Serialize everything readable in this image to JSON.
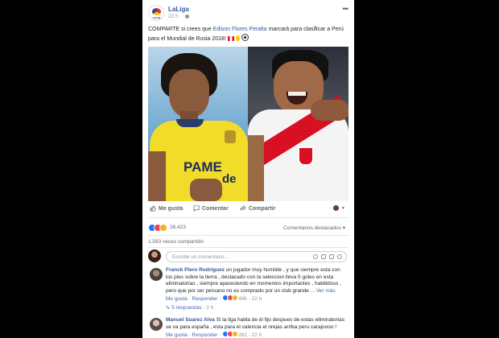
{
  "post": {
    "page_name": "LaLiga",
    "time": "22 h",
    "logo_text": "LaLiga",
    "text_before": "COMPARTE si crees que ",
    "text_link": "Edison Flores Peralta",
    "text_after": " marcará para clasificar a Perú para el Mundial de Rusia 2018! "
  },
  "photo": {
    "left_shirt_text": "PAME",
    "left_shirt_text2": "de"
  },
  "actions": {
    "like": "Me gusta",
    "comment": "Comentar",
    "share": "Compartir"
  },
  "reactions": {
    "count": "26.423",
    "sort_label": "Comentarios destacados",
    "shares": "1.593 veces compartido"
  },
  "composer": {
    "placeholder": "Escribe un comentario..."
  },
  "comments": [
    {
      "name": "Franck Piero Rodriguez",
      "body": " un jugador muy humilde , y que siempre esta con los pies sobre la tierra , destacado con la seleccion lleva 5 goles en esta eliminatorias , siempre apareciendo en momentos importantes , habilidoso , pero que por ser peruano no es comprado por un club grande ",
      "more": "... Ver más",
      "like": "Me gusta",
      "reply": "Responder",
      "count": "496",
      "time": "22 h"
    },
    {
      "name": "Manuel Suarez Alva",
      "body": " Si la liga habla de él fijo despues de estas eliminatorias se va para españa , esta para el valencia el orejas arriba peru carajoooo !",
      "like": "Me gusta",
      "reply": "Responder",
      "count": "282",
      "time": "22 h"
    }
  ],
  "replies": {
    "label": "5 respuestas",
    "time": "2 h"
  },
  "colors": {
    "link": "#365899",
    "like": "#1877f2",
    "love": "#f33e58",
    "haha": "#f7b125"
  }
}
